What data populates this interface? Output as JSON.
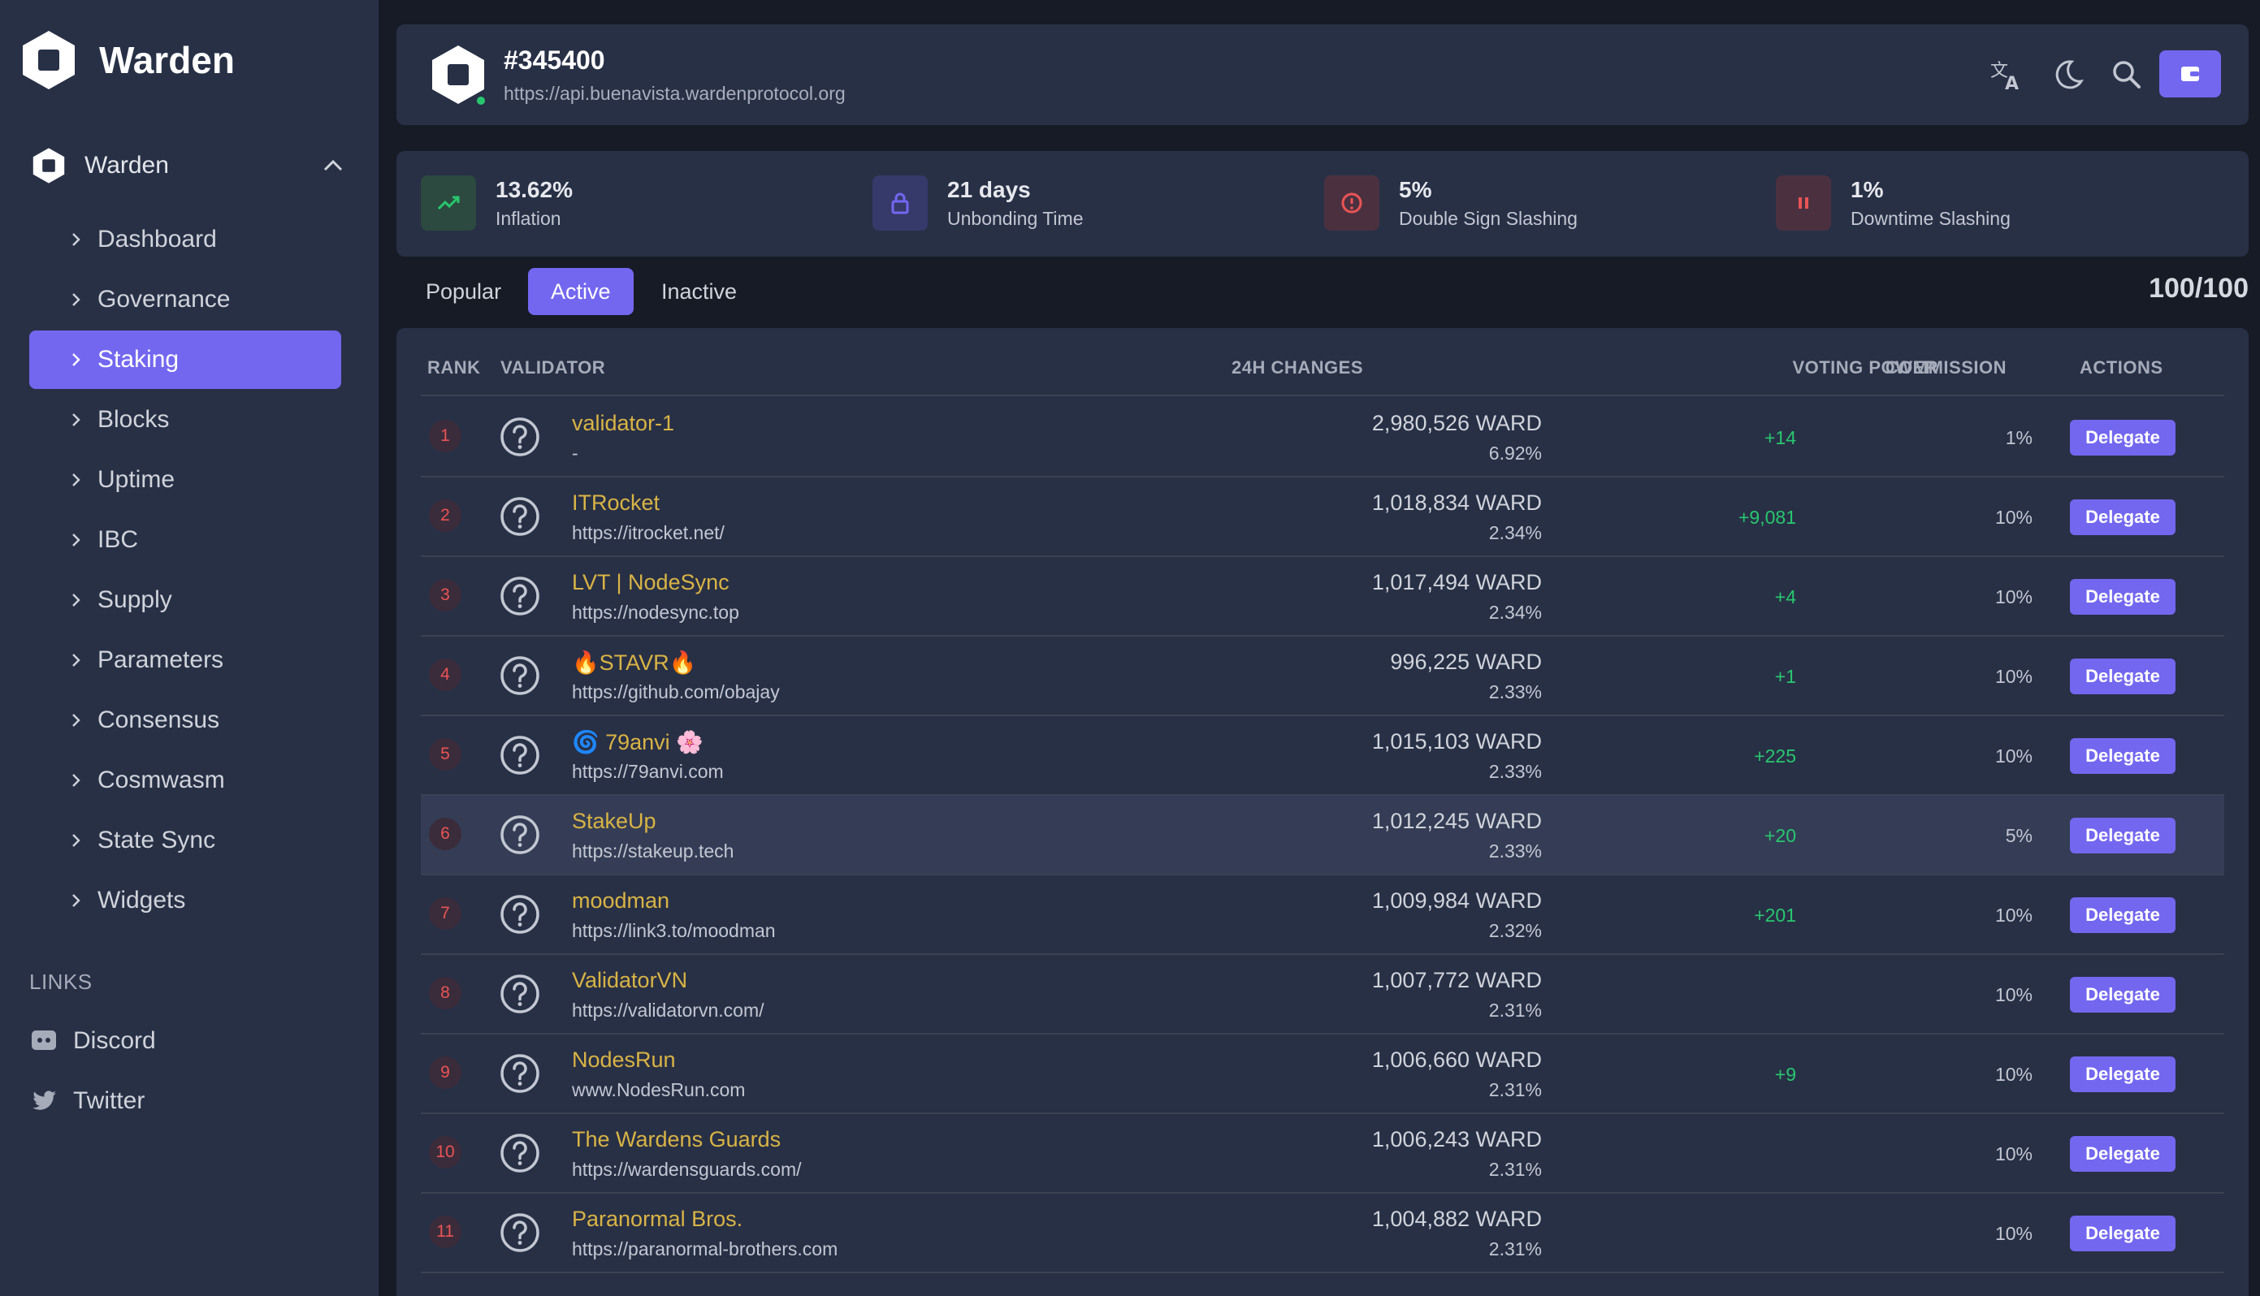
{
  "app": {
    "name": "Warden"
  },
  "sidebar": {
    "group_label": "Warden",
    "items": [
      {
        "label": "Dashboard"
      },
      {
        "label": "Governance"
      },
      {
        "label": "Staking",
        "active": true
      },
      {
        "label": "Blocks"
      },
      {
        "label": "Uptime"
      },
      {
        "label": "IBC"
      },
      {
        "label": "Supply"
      },
      {
        "label": "Parameters"
      },
      {
        "label": "Consensus"
      },
      {
        "label": "Cosmwasm"
      },
      {
        "label": "State Sync"
      },
      {
        "label": "Widgets"
      }
    ],
    "links_heading": "LINKS",
    "links": [
      {
        "label": "Discord",
        "icon": "discord-icon"
      },
      {
        "label": "Twitter",
        "icon": "twitter-icon"
      }
    ]
  },
  "header": {
    "block": "#345400",
    "endpoint": "https://api.buenavista.wardenprotocol.org",
    "icons": [
      "translate-icon",
      "moon-icon",
      "search-icon",
      "wallet-icon"
    ]
  },
  "stats": [
    {
      "value": "13.62%",
      "label": "Inflation",
      "icon": "trending-up-icon",
      "color": "#28c76f"
    },
    {
      "value": "21 days",
      "label": "Unbonding Time",
      "icon": "lock-icon",
      "color": "#7367f0"
    },
    {
      "value": "5%",
      "label": "Double Sign Slashing",
      "icon": "alert-circle-icon",
      "color": "#ea5455"
    },
    {
      "value": "1%",
      "label": "Downtime Slashing",
      "icon": "pause-icon",
      "color": "#ea5455"
    }
  ],
  "tabs": [
    {
      "label": "Popular"
    },
    {
      "label": "Active",
      "active": true
    },
    {
      "label": "Inactive"
    }
  ],
  "count": "100/100",
  "table": {
    "columns": [
      "RANK",
      "VALIDATOR",
      "VOTING POWER",
      "24H CHANGES",
      "COMMISSION",
      "ACTIONS"
    ],
    "action_label": "Delegate",
    "rows": [
      {
        "rank": "1",
        "name": "validator-1",
        "site": "-",
        "power": "2,980,526 WARD",
        "pct": "6.92%",
        "change": "+14",
        "commission": "1%"
      },
      {
        "rank": "2",
        "name": "ITRocket",
        "site": "https://itrocket.net/",
        "power": "1,018,834 WARD",
        "pct": "2.34%",
        "change": "+9,081",
        "commission": "10%"
      },
      {
        "rank": "3",
        "name": "LVT | NodeSync",
        "site": "https://nodesync.top",
        "power": "1,017,494 WARD",
        "pct": "2.34%",
        "change": "+4",
        "commission": "10%"
      },
      {
        "rank": "4",
        "name": "🔥STAVR🔥",
        "site": "https://github.com/obajay",
        "power": "996,225 WARD",
        "pct": "2.33%",
        "change": "+1",
        "commission": "10%"
      },
      {
        "rank": "5",
        "name": "🌀 79anvi 🌸",
        "site": "https://79anvi.com",
        "power": "1,015,103 WARD",
        "pct": "2.33%",
        "change": "+225",
        "commission": "10%"
      },
      {
        "rank": "6",
        "name": "StakeUp",
        "site": "https://stakeup.tech",
        "power": "1,012,245 WARD",
        "pct": "2.33%",
        "change": "+20",
        "commission": "5%",
        "highlight": true
      },
      {
        "rank": "7",
        "name": "moodman",
        "site": "https://link3.to/moodman",
        "power": "1,009,984 WARD",
        "pct": "2.32%",
        "change": "+201",
        "commission": "10%"
      },
      {
        "rank": "8",
        "name": "ValidatorVN",
        "site": "https://validatorvn.com/",
        "power": "1,007,772 WARD",
        "pct": "2.31%",
        "change": "",
        "commission": "10%"
      },
      {
        "rank": "9",
        "name": "NodesRun",
        "site": "www.NodesRun.com",
        "power": "1,006,660 WARD",
        "pct": "2.31%",
        "change": "+9",
        "commission": "10%"
      },
      {
        "rank": "10",
        "name": "The Wardens Guards",
        "site": "https://wardensguards.com/",
        "power": "1,006,243 WARD",
        "pct": "2.31%",
        "change": "",
        "commission": "10%"
      },
      {
        "rank": "11",
        "name": "Paranormal Bros.",
        "site": "https://paranormal-brothers.com",
        "power": "1,004,882 WARD",
        "pct": "2.31%",
        "change": "",
        "commission": "10%"
      }
    ]
  }
}
